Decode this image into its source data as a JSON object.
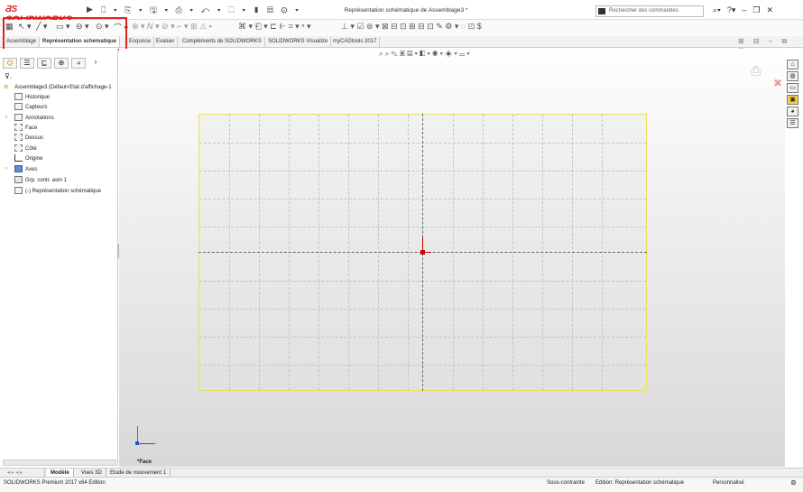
{
  "app": {
    "logo_text": "SOLIDWORKS",
    "window_title": "Représentation schématique de Assemblage3 *",
    "search_placeholder": "Rechercher des commandes"
  },
  "tabs": [
    {
      "label": "Assemblage"
    },
    {
      "label": "Représentation schématique"
    },
    {
      "label": "Esquisse"
    },
    {
      "label": "Evaluer"
    },
    {
      "label": "Compléments de SOLIDWORKS"
    },
    {
      "label": "SOLIDWORKS Visualize"
    },
    {
      "label": "myCADtools 2017"
    }
  ],
  "tree": {
    "root": "Assemblage3 (Défaut<Etat d'affichage-1",
    "items": [
      {
        "label": "Historique",
        "icon": "history-icon"
      },
      {
        "label": "Capteurs",
        "icon": "sensors-icon"
      },
      {
        "label": "Annotations",
        "icon": "annotations-icon"
      },
      {
        "label": "Face",
        "icon": "plane-icon"
      },
      {
        "label": "Dessus",
        "icon": "plane-icon"
      },
      {
        "label": "Côté",
        "icon": "plane-icon"
      },
      {
        "label": "Origine",
        "icon": "origin-icon"
      },
      {
        "label": "Axes",
        "icon": "folder-icon"
      },
      {
        "label": "Grp. contr. asm 1",
        "icon": "constraint-group-icon"
      },
      {
        "label": "(-) Représentation schématique",
        "icon": "schematic-icon"
      }
    ]
  },
  "viewport": {
    "view_label": "*Face"
  },
  "bottom_tabs": [
    {
      "label": "Modèle"
    },
    {
      "label": "Vues 3D"
    },
    {
      "label": "Etude de mouvement 1"
    }
  ],
  "status": {
    "edition": "SOLIDWORKS Premium 2017 x64 Edition",
    "constraint": "Sous-contrainte",
    "editing": "Edition: Représentation schématique",
    "custom": "Personnalisé"
  },
  "colors": {
    "highlight": "#e0231c",
    "sheet_border": "#e8e060",
    "origin": "#cc0000"
  }
}
